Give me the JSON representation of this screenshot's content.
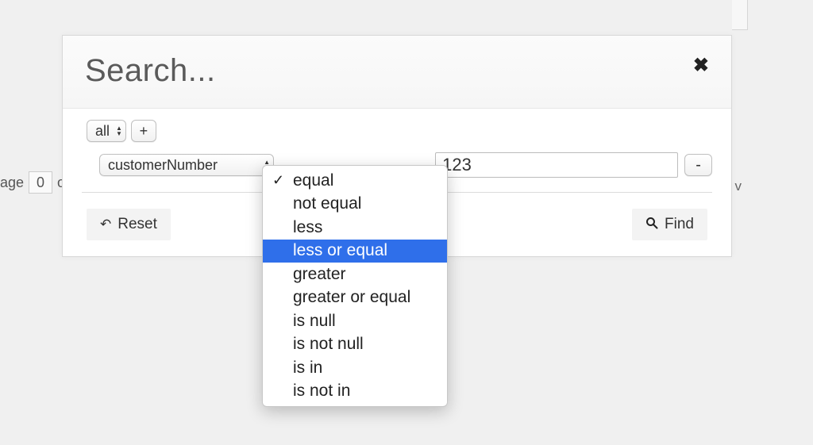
{
  "bg": {
    "page_label_prefix": "age",
    "page_val": "0",
    "page_label_suffix": "o",
    "right_frag": "v"
  },
  "dialog": {
    "title": "Search..."
  },
  "match": {
    "selected": "all",
    "add": "+"
  },
  "rule": {
    "field": "customerNumber",
    "value": "123",
    "remove": "-"
  },
  "operators": {
    "items": [
      {
        "label": "equal",
        "selected": true,
        "hl": false
      },
      {
        "label": "not equal",
        "selected": false,
        "hl": false
      },
      {
        "label": "less",
        "selected": false,
        "hl": false
      },
      {
        "label": "less or equal",
        "selected": false,
        "hl": true
      },
      {
        "label": "greater",
        "selected": false,
        "hl": false
      },
      {
        "label": "greater or equal",
        "selected": false,
        "hl": false
      },
      {
        "label": "is null",
        "selected": false,
        "hl": false
      },
      {
        "label": "is not null",
        "selected": false,
        "hl": false
      },
      {
        "label": "is in",
        "selected": false,
        "hl": false
      },
      {
        "label": "is not in",
        "selected": false,
        "hl": false
      }
    ]
  },
  "buttons": {
    "reset": "Reset",
    "find": "Find"
  }
}
